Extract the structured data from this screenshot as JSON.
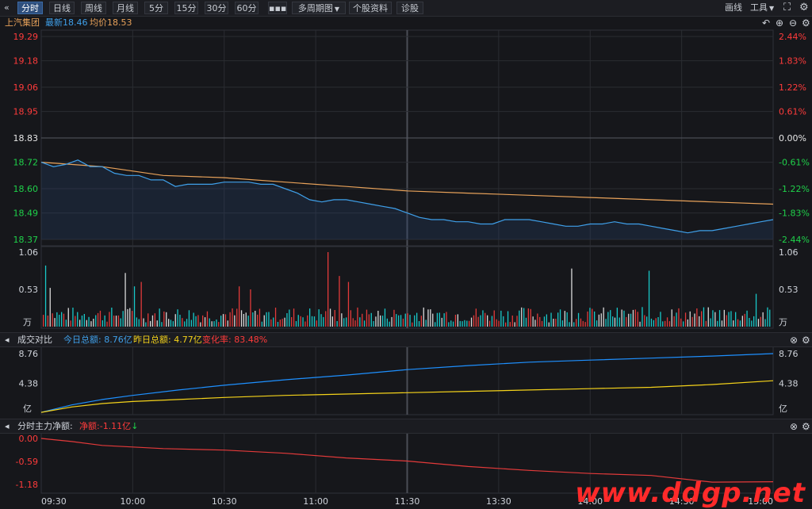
{
  "toolbar": {
    "back_icon": "double-chevron-left-icon",
    "tabs": [
      {
        "label": "分时",
        "active": true
      },
      {
        "label": "日线",
        "active": false
      },
      {
        "label": "周线",
        "active": false
      },
      {
        "label": "月线",
        "active": false
      },
      {
        "label": "5分",
        "active": false
      },
      {
        "label": "15分",
        "active": false
      },
      {
        "label": "30分",
        "active": false
      },
      {
        "label": "60分",
        "active": false
      }
    ],
    "more_label": "▪▪▪",
    "multi_period": "多周期图",
    "stock_info": "个股资料",
    "diagnose": "诊股",
    "draw": "画线",
    "tools": "工具"
  },
  "info": {
    "name": "上汽集团",
    "latest_label": "最新",
    "latest_value": "18.46",
    "avg_label": "均价",
    "avg_value": "18.53"
  },
  "colors": {
    "up": "#ff3b3b",
    "down": "#1fd14a",
    "price": "#3fa0ea",
    "avg": "#e8a25a",
    "today": "#1e90ff",
    "yesterday": "#f5d31a",
    "flow": "#e33a3a"
  },
  "chart_data": [
    {
      "type": "line",
      "name": "分时",
      "ylim": [
        18.37,
        19.29
      ],
      "y_ticks": [
        "19.29",
        "19.18",
        "19.06",
        "18.95",
        "18.83",
        "18.72",
        "18.60",
        "18.49",
        "18.37"
      ],
      "pct_ticks": [
        "2.44%",
        "1.83%",
        "1.22%",
        "0.61%",
        "0.00%",
        "-0.61%",
        "-1.22%",
        "-1.83%",
        "-2.44%"
      ],
      "x_ticks": [
        "09:30",
        "10:00",
        "10:30",
        "11:00",
        "11:30",
        "13:30",
        "14:00",
        "14:30",
        "15:00"
      ],
      "price": [
        [
          0,
          18.72
        ],
        [
          4,
          18.7
        ],
        [
          8,
          18.71
        ],
        [
          12,
          18.73
        ],
        [
          16,
          18.7
        ],
        [
          20,
          18.7
        ],
        [
          24,
          18.67
        ],
        [
          28,
          18.66
        ],
        [
          32,
          18.66
        ],
        [
          36,
          18.64
        ],
        [
          40,
          18.64
        ],
        [
          44,
          18.61
        ],
        [
          48,
          18.62
        ],
        [
          52,
          18.62
        ],
        [
          56,
          18.62
        ],
        [
          60,
          18.63
        ],
        [
          64,
          18.63
        ],
        [
          68,
          18.63
        ],
        [
          72,
          18.62
        ],
        [
          76,
          18.62
        ],
        [
          80,
          18.6
        ],
        [
          84,
          18.58
        ],
        [
          88,
          18.55
        ],
        [
          92,
          18.54
        ],
        [
          96,
          18.55
        ],
        [
          100,
          18.55
        ],
        [
          104,
          18.54
        ],
        [
          108,
          18.53
        ],
        [
          112,
          18.52
        ],
        [
          116,
          18.51
        ],
        [
          120,
          18.49
        ],
        [
          124,
          18.47
        ],
        [
          128,
          18.46
        ],
        [
          132,
          18.46
        ],
        [
          136,
          18.45
        ],
        [
          140,
          18.45
        ],
        [
          144,
          18.44
        ],
        [
          148,
          18.44
        ],
        [
          152,
          18.46
        ],
        [
          156,
          18.46
        ],
        [
          160,
          18.46
        ],
        [
          164,
          18.45
        ],
        [
          168,
          18.44
        ],
        [
          172,
          18.43
        ],
        [
          176,
          18.43
        ],
        [
          180,
          18.44
        ],
        [
          184,
          18.44
        ],
        [
          188,
          18.45
        ],
        [
          192,
          18.44
        ],
        [
          196,
          18.44
        ],
        [
          200,
          18.43
        ],
        [
          204,
          18.42
        ],
        [
          208,
          18.41
        ],
        [
          212,
          18.4
        ],
        [
          216,
          18.41
        ],
        [
          220,
          18.41
        ],
        [
          224,
          18.42
        ],
        [
          228,
          18.43
        ],
        [
          232,
          18.44
        ],
        [
          236,
          18.45
        ],
        [
          240,
          18.46
        ]
      ],
      "avg": [
        [
          0,
          18.72
        ],
        [
          20,
          18.7
        ],
        [
          40,
          18.66
        ],
        [
          60,
          18.65
        ],
        [
          80,
          18.63
        ],
        [
          100,
          18.61
        ],
        [
          120,
          18.59
        ],
        [
          140,
          18.58
        ],
        [
          160,
          18.57
        ],
        [
          180,
          18.56
        ],
        [
          200,
          18.55
        ],
        [
          220,
          18.54
        ],
        [
          240,
          18.53
        ]
      ]
    },
    {
      "type": "bar",
      "name": "成交量",
      "unit": "万",
      "ylim": [
        0,
        1.06
      ],
      "y_ticks": [
        "1.06",
        "0.53"
      ]
    },
    {
      "type": "line",
      "name": "成交对比",
      "header": {
        "title": "成交对比",
        "today_label": "今日总额:",
        "today_value": "8.76亿",
        "yesterday_label": "昨日总额:",
        "yesterday_value": "4.77亿",
        "change_label": "变化率:",
        "change_value": "83.48%"
      },
      "ylim": [
        0,
        8.76
      ],
      "y_ticks": [
        "8.76",
        "4.38"
      ],
      "unit": "亿",
      "series": [
        {
          "name": "今日总额",
          "points": [
            [
              0,
              0.1
            ],
            [
              10,
              1.2
            ],
            [
              20,
              2.0
            ],
            [
              30,
              2.6
            ],
            [
              45,
              3.4
            ],
            [
              60,
              4.1
            ],
            [
              80,
              4.9
            ],
            [
              100,
              5.6
            ],
            [
              120,
              6.4
            ],
            [
              140,
              7.0
            ],
            [
              160,
              7.5
            ],
            [
              180,
              7.8
            ],
            [
              200,
              8.1
            ],
            [
              220,
              8.4
            ],
            [
              240,
              8.76
            ]
          ]
        },
        {
          "name": "昨日总额",
          "points": [
            [
              0,
              0.1
            ],
            [
              10,
              0.9
            ],
            [
              20,
              1.4
            ],
            [
              30,
              1.7
            ],
            [
              45,
              2.0
            ],
            [
              60,
              2.3
            ],
            [
              80,
              2.6
            ],
            [
              100,
              2.8
            ],
            [
              120,
              3.0
            ],
            [
              140,
              3.2
            ],
            [
              160,
              3.4
            ],
            [
              180,
              3.6
            ],
            [
              200,
              3.8
            ],
            [
              220,
              4.2
            ],
            [
              240,
              4.77
            ]
          ]
        }
      ]
    },
    {
      "type": "line",
      "name": "分时主力净额",
      "header": {
        "title": "分时主力净额:",
        "net_label": "净额:",
        "net_value": "-1.11亿",
        "arrow": "↓"
      },
      "ylim": [
        -1.18,
        0.0
      ],
      "y_ticks": [
        "0.00",
        "-0.59",
        "-1.18"
      ],
      "series": [
        {
          "name": "净额",
          "points": [
            [
              0,
              0.0
            ],
            [
              10,
              -0.08
            ],
            [
              20,
              -0.18
            ],
            [
              30,
              -0.22
            ],
            [
              40,
              -0.26
            ],
            [
              60,
              -0.3
            ],
            [
              80,
              -0.38
            ],
            [
              100,
              -0.5
            ],
            [
              120,
              -0.58
            ],
            [
              140,
              -0.72
            ],
            [
              160,
              -0.82
            ],
            [
              180,
              -0.9
            ],
            [
              200,
              -0.95
            ],
            [
              220,
              -1.12
            ],
            [
              240,
              -1.11
            ]
          ]
        }
      ]
    }
  ],
  "watermark": "www.ddgp.net"
}
